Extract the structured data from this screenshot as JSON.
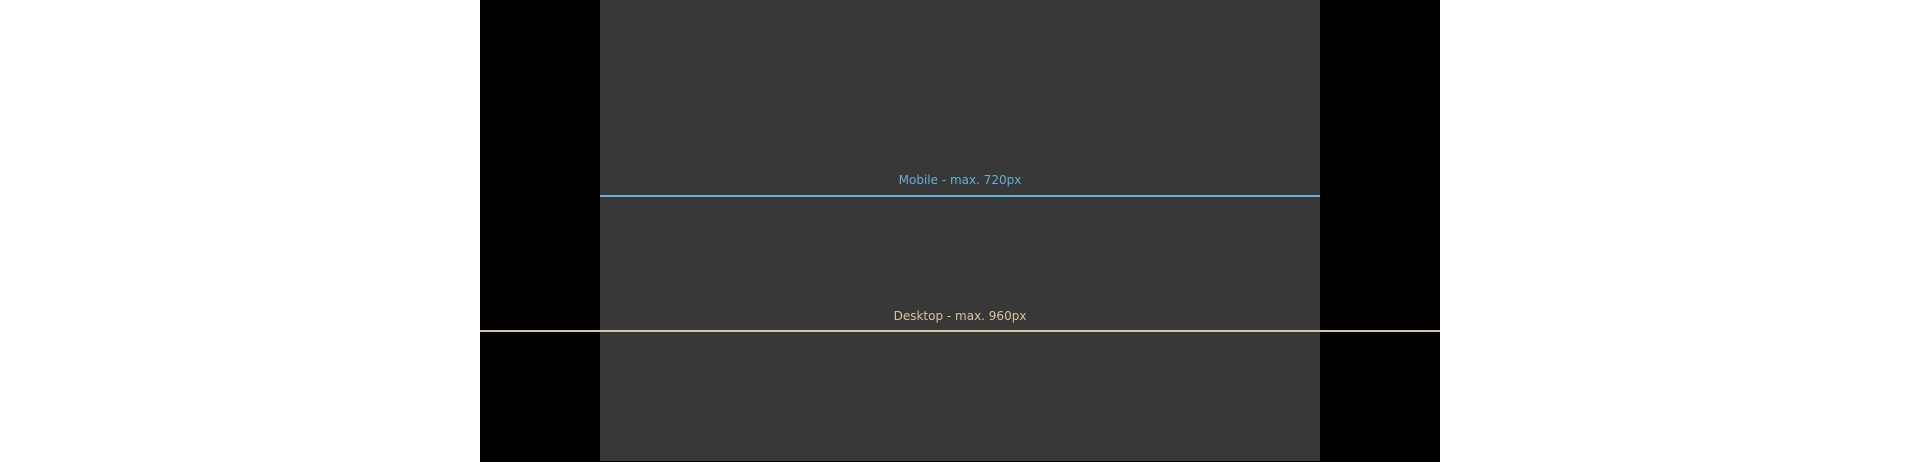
{
  "colors": {
    "page_background": "#ffffff",
    "frame_background": "#000000",
    "content_background": "#383838",
    "mobile_accent": "#5fb3d6",
    "desktop_accent": "#d6c79a"
  },
  "breakpoints": {
    "mobile": {
      "label": "Mobile - max. 720px"
    },
    "desktop": {
      "label": "Desktop - max. 960px"
    }
  }
}
